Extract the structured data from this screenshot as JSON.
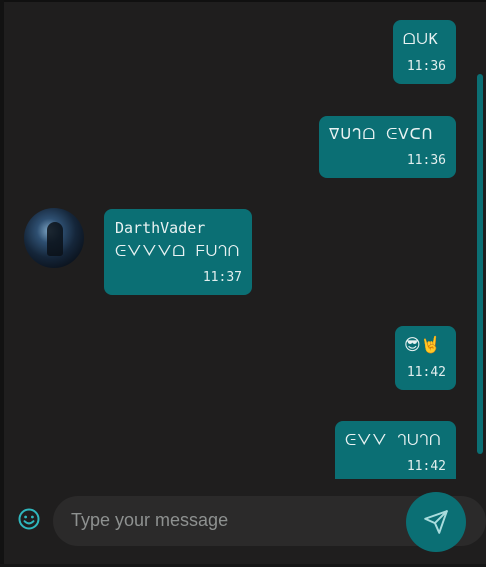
{
  "messages": [
    {
      "text": "ᗝᑌK",
      "time": "11:36"
    },
    {
      "text": "ᐁᑌᒉᗝ ᕮᐯᑕᑎ",
      "time": "11:36"
    },
    {
      "sender": "DarthVader",
      "text": "ᕮᐯᐯᐯᗝ ᖴᑌᒉᑎ",
      "time": "11:37"
    },
    {
      "text": "😎🤘",
      "time": "11:42"
    },
    {
      "text": "ᕮᐯᐯ ᒉᑌᒉᑎ",
      "time": "11:42"
    }
  ],
  "composer": {
    "placeholder": "Type your message"
  },
  "icons": {
    "emoji": "smile-icon",
    "send": "send-icon"
  },
  "colors": {
    "bubble": "#0b6f74",
    "background": "#1f1e1e",
    "input": "#2b2a2a"
  }
}
